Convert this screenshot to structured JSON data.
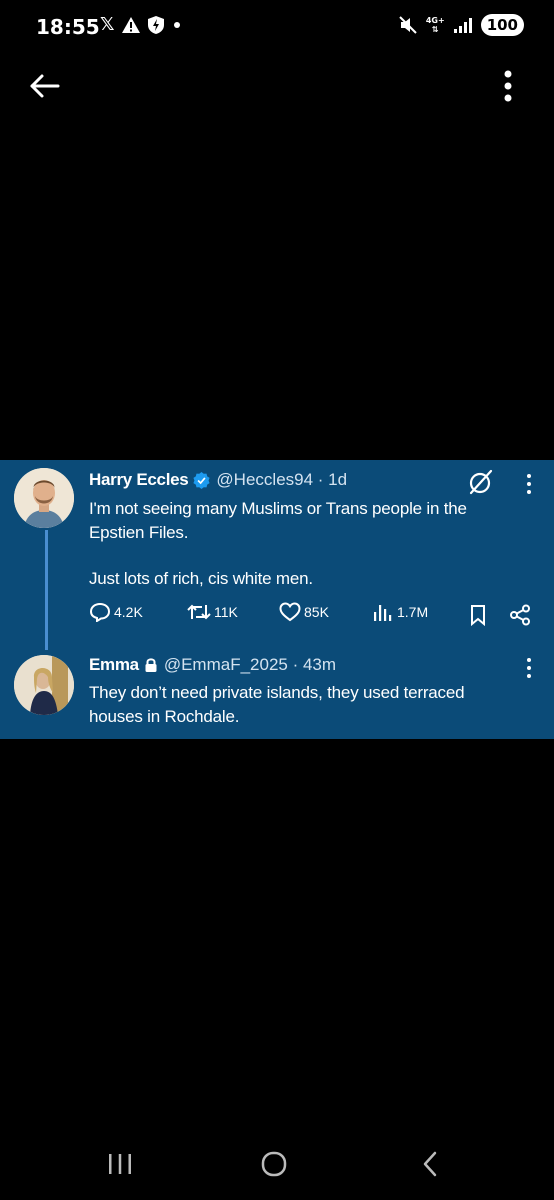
{
  "status_bar": {
    "time": "18:55",
    "left_icons": [
      "x-logo-icon",
      "warning-icon",
      "shield-icon",
      "dot-icon"
    ],
    "network_label": "4G+",
    "battery": "100"
  },
  "toolbar": {
    "back_icon": "arrow-left-icon",
    "more_icon": "more-vertical-icon"
  },
  "tweet": {
    "author_name": "Harry Eccles",
    "handle_time": "@Heccles94 · 1d",
    "verified": true,
    "text_line1": "I'm not seeing many Muslims or Trans people in the",
    "text_line2": "Epstien Files.",
    "text_line3": "Just lots of rich, cis white men.",
    "replies": "4.2K",
    "reposts": "11K",
    "likes": "85K",
    "views": "1.7M"
  },
  "reply": {
    "author_name": "Emma",
    "handle_time": "@EmmaF_2025 · 43m",
    "protected": true,
    "text_line1": "They don’t need private islands, they used terraced",
    "text_line2": "houses in Rochdale."
  },
  "colors": {
    "card_background": "#0b4b78",
    "thread_line": "#4a8ed0",
    "verified_badge": "#1d9bf0",
    "page_background": "#000000"
  },
  "nav_bar": {
    "icons": [
      "recent-apps-icon",
      "home-icon",
      "back-icon"
    ]
  }
}
